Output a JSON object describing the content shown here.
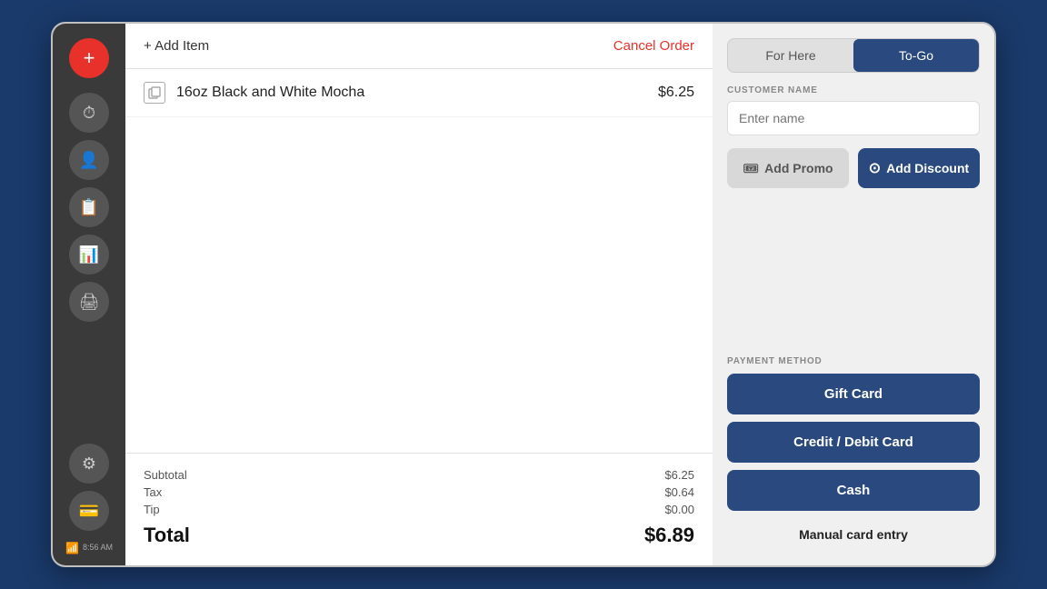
{
  "sidebar": {
    "add_label": "+",
    "time_label": "8:56 AM",
    "icons": [
      {
        "name": "clock-icon",
        "symbol": "⏱"
      },
      {
        "name": "person-icon",
        "symbol": "👤"
      },
      {
        "name": "clipboard-icon",
        "symbol": "📋"
      },
      {
        "name": "chart-icon",
        "symbol": "📊"
      },
      {
        "name": "register-icon",
        "symbol": "🖨"
      },
      {
        "name": "settings-icon",
        "symbol": "⚙"
      },
      {
        "name": "card-icon",
        "symbol": "💳"
      }
    ]
  },
  "order": {
    "add_item_label": "+ Add Item",
    "cancel_label": "Cancel Order",
    "items": [
      {
        "name": "16oz Black and White Mocha",
        "price": "$6.25"
      }
    ],
    "subtotal_label": "Subtotal",
    "subtotal_value": "$6.25",
    "tax_label": "Tax",
    "tax_value": "$0.64",
    "tip_label": "Tip",
    "tip_value": "$0.00",
    "total_label": "Total",
    "total_value": "$6.89"
  },
  "order_type": {
    "for_here_label": "For Here",
    "to_go_label": "To-Go",
    "active": "to_go"
  },
  "customer": {
    "label": "CUSTOMER NAME",
    "placeholder": "Enter name"
  },
  "promo": {
    "label": "Add Promo",
    "icon": "🎟"
  },
  "discount": {
    "label": "Add Discount",
    "icon": "⊙"
  },
  "payment": {
    "label": "PAYMENT METHOD",
    "gift_card": "Gift Card",
    "credit_debit": "Credit / Debit Card",
    "cash": "Cash",
    "manual": "Manual card entry"
  }
}
